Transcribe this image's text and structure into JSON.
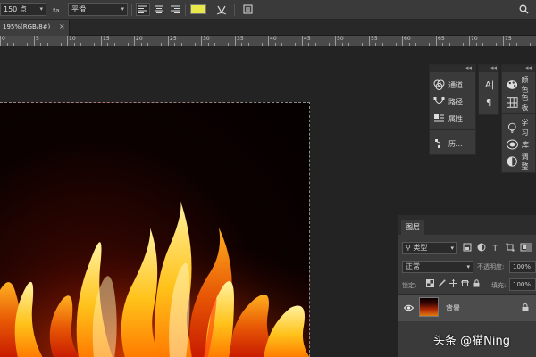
{
  "options_bar": {
    "font_size": "150 点",
    "aa_icon": "anti-alias-icon",
    "anti_alias": "平滑",
    "align_icons": [
      "align-left-icon",
      "align-center-icon",
      "align-right-icon"
    ],
    "text_color": "#e8e84a",
    "warp_icon": "warp-text-icon",
    "panels_icon": "character-panels-icon",
    "search_icon": "search-icon"
  },
  "document": {
    "tab_label": "195%(RGB/8#)",
    "close": "×"
  },
  "ruler": {
    "labels": [
      "0",
      "5",
      "10",
      "15",
      "20",
      "25",
      "30",
      "35",
      "40",
      "45",
      "50",
      "55",
      "60",
      "65",
      "70",
      "75"
    ]
  },
  "panel_left": {
    "items": [
      {
        "icon": "channels-icon",
        "label": "通道"
      },
      {
        "icon": "paths-icon",
        "label": "路径"
      },
      {
        "icon": "properties-icon",
        "label": "属性"
      },
      {
        "icon": "history-icon",
        "label": "历..."
      }
    ]
  },
  "panel_mid": {
    "items": [
      {
        "icon": "character-icon",
        "label": "A|"
      },
      {
        "icon": "paragraph-icon",
        "label": "¶"
      }
    ]
  },
  "panel_right": {
    "items": [
      {
        "icon": "color-icon",
        "label": "颜色"
      },
      {
        "icon": "swatches-icon",
        "label": "色板"
      },
      {
        "icon": "learn-icon",
        "label": "学习"
      },
      {
        "icon": "libraries-icon",
        "label": "库"
      },
      {
        "icon": "adjustments-icon",
        "label": "调整"
      }
    ]
  },
  "layers": {
    "title": "图层",
    "filter_label": "类型",
    "blend_mode": "正常",
    "opacity_label": "不透明度:",
    "opacity_value": "100%",
    "lock_label": "锁定:",
    "fill_label": "填充:",
    "fill_value": "100%",
    "layer_name": "背景"
  },
  "watermark": "头条 @猫Ning"
}
